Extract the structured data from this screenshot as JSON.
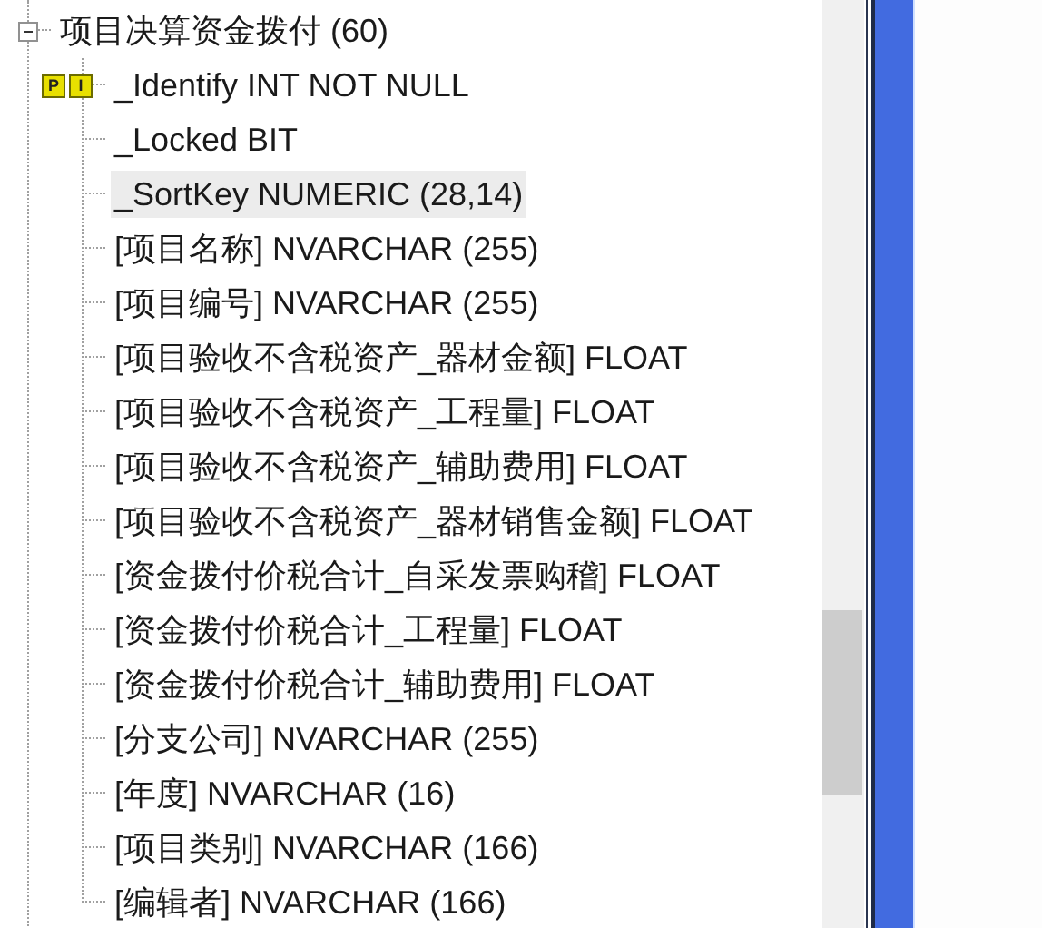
{
  "tree": {
    "label": "项目决算资金拨付 (60)",
    "expanded": true,
    "children": [
      {
        "label": "_Identify INT NOT NULL",
        "badges": [
          "P",
          "I"
        ],
        "selected": false
      },
      {
        "label": "_Locked BIT",
        "selected": false
      },
      {
        "label": "_SortKey NUMERIC (28,14)",
        "selected": true
      },
      {
        "label": "[项目名称] NVARCHAR (255)",
        "selected": false
      },
      {
        "label": "[项目编号] NVARCHAR (255)",
        "selected": false
      },
      {
        "label": "[项目验收不含税资产_器材金额] FLOAT",
        "selected": false
      },
      {
        "label": "[项目验收不含税资产_工程量] FLOAT",
        "selected": false
      },
      {
        "label": "[项目验收不含税资产_辅助费用] FLOAT",
        "selected": false
      },
      {
        "label": "[项目验收不含税资产_器材销售金额] FLOAT",
        "selected": false
      },
      {
        "label": "[资金拨付价税合计_自采发票购稽] FLOAT",
        "selected": false
      },
      {
        "label": "[资金拨付价税合计_工程量] FLOAT",
        "selected": false
      },
      {
        "label": "[资金拨付价税合计_辅助费用] FLOAT",
        "selected": false
      },
      {
        "label": "[分支公司] NVARCHAR (255)",
        "selected": false
      },
      {
        "label": "[年度] NVARCHAR (16)",
        "selected": false
      },
      {
        "label": "[项目类别] NVARCHAR (166)",
        "selected": false
      },
      {
        "label": "[编辑者] NVARCHAR (166)",
        "selected": false
      }
    ]
  }
}
